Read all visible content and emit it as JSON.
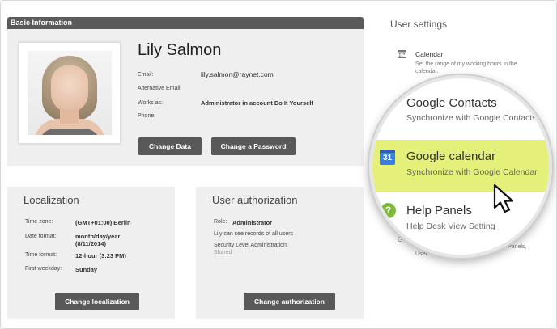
{
  "basic": {
    "header": "Basic Information",
    "name": "Lily Salmon",
    "fields": [
      {
        "label": "Email:",
        "value": "lily.salmon@raynet.com"
      },
      {
        "label": "Alternative Email:",
        "value": ""
      },
      {
        "label": "Works as:",
        "value": "Administrator in account Do It Yourself"
      },
      {
        "label": "Phone:",
        "value": ""
      }
    ],
    "change_data": "Change Data",
    "change_password": "Change a Password"
  },
  "localization": {
    "title": "Localization",
    "rows": [
      {
        "label": "Time zone:",
        "value": "(GMT+01:00) Berlin"
      },
      {
        "label": "Date format:",
        "value": "month/day/year",
        "value2": "(8/11/2014)"
      },
      {
        "label": "Time format:",
        "value": "12-hour (3:23 PM)"
      },
      {
        "label": "First weekday:",
        "value": "Sunday"
      }
    ],
    "button": "Change localization"
  },
  "auth": {
    "title": "User authorization",
    "role_label": "Role:",
    "role_value": "Administrator",
    "records": "Lily can see records of all users",
    "security_label": "Security Level Administration:",
    "security_value": "Shared",
    "button": "Change authorization"
  },
  "user_settings": {
    "title": "User settings",
    "calendar": {
      "title": "Calendar",
      "desc_line1": "Set the range of my working hours in the",
      "desc_line2": "calendar."
    },
    "behind_text_1": "Panels,",
    "behind_text_2": "User...ta...(lendar...",
    "behind_g": "G"
  },
  "magnifier": {
    "google_contacts": {
      "title": "Google Contacts",
      "desc": "Synchronize with Google Contacts"
    },
    "google_calendar": {
      "title": "Google calendar",
      "desc": "Synchronize with Google Calendar",
      "icon_text": "31"
    },
    "help_panels": {
      "title": "Help Panels",
      "desc": "Help Desk View Setting"
    }
  },
  "colors": {
    "highlight": "#e4f07a",
    "button": "#595959",
    "panel": "#efefef",
    "calendar_icon": "#3a7de0",
    "help_icon": "#7fb83d"
  }
}
